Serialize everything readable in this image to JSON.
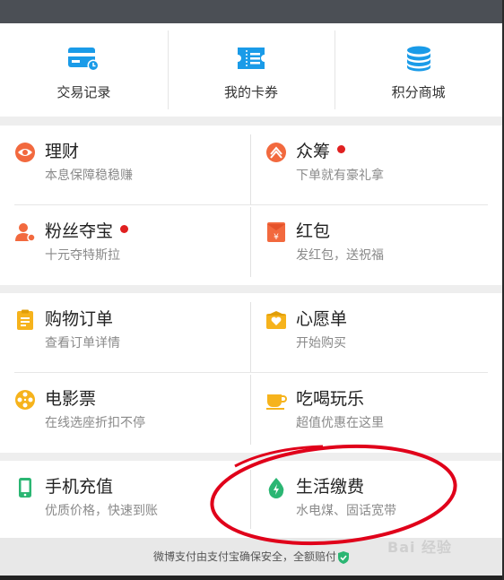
{
  "shortcuts": [
    {
      "label": "交易记录",
      "icon": "card-clock-icon"
    },
    {
      "label": "我的卡券",
      "icon": "ticket-icon"
    },
    {
      "label": "积分商城",
      "icon": "coin-stack-icon"
    }
  ],
  "services": {
    "finance": {
      "title": "理财",
      "subtitle": "本息保障稳稳赚",
      "icon": "eye-icon"
    },
    "crowdfund": {
      "title": "众筹",
      "subtitle": "下单就有豪礼拿",
      "icon": "crowdfund-icon"
    },
    "fans": {
      "title": "粉丝夺宝",
      "subtitle": "十元夺特斯拉",
      "icon": "person-icon"
    },
    "redpacket": {
      "title": "红包",
      "subtitle": "发红包，送祝福",
      "icon": "red-packet-icon"
    },
    "orders": {
      "title": "购物订单",
      "subtitle": "查看订单详情",
      "icon": "clipboard-icon"
    },
    "wishlist": {
      "title": "心愿单",
      "subtitle": "开始购买",
      "icon": "heart-box-icon"
    },
    "movie": {
      "title": "电影票",
      "subtitle": "在线选座折扣不停",
      "icon": "film-reel-icon"
    },
    "food": {
      "title": "吃喝玩乐",
      "subtitle": "超值优惠在这里",
      "icon": "cup-icon"
    },
    "topup": {
      "title": "手机充值",
      "subtitle": "优质价格，快速到账",
      "icon": "phone-icon"
    },
    "utilities": {
      "title": "生活缴费",
      "subtitle": "水电煤、固话宽带",
      "icon": "water-drop-icon"
    }
  },
  "footer": {
    "text": "微博支付由支付宝确保安全，全额赔付"
  },
  "watermark": {
    "text": "Bai 经验"
  },
  "colors": {
    "blue": "#1a9be8",
    "orange": "#f2693e",
    "yellow": "#f6b31c",
    "green": "#2bb673",
    "red_dot": "#e02020",
    "annotation": "#e0001a"
  }
}
